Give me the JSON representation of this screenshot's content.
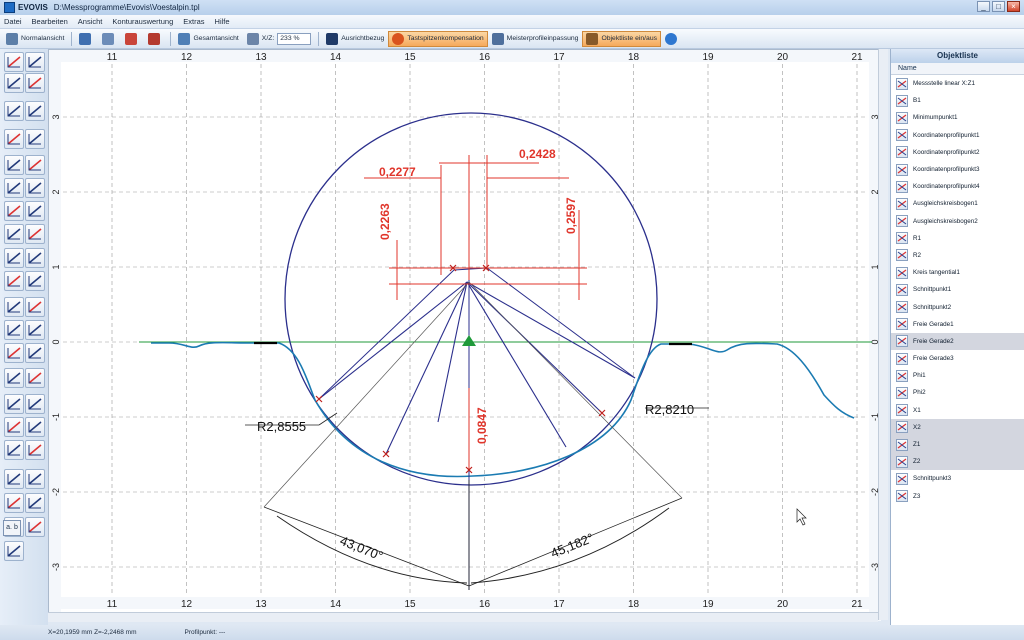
{
  "window": {
    "app_name": "EVOVIS",
    "path": "D:\\Messprogramme\\Evovis\\Voestalpin.tpl"
  },
  "menu": [
    "Datei",
    "Bearbeiten",
    "Ansicht",
    "Konturauswertung",
    "Extras",
    "Hilfe"
  ],
  "toolbar": {
    "normalansicht": "Normalansicht",
    "gesamtansicht": "Gesamtansicht",
    "xz_label": "X/Z:",
    "zoom": "233 %",
    "ausrichtbezug": "Ausrichtbezug",
    "tastspitzen": "Tastspitzenkompensation",
    "meisterprofil": "Meisterprofileinpassung",
    "objektliste": "Objektliste ein/aus"
  },
  "left_tab": "a. b",
  "statusbar": {
    "coords": "X=20,1959 mm Z=-2,2468 mm",
    "profilpunkt": "Profilpunkt: ---"
  },
  "objektliste": {
    "title": "Objektliste",
    "column": "Name",
    "items": [
      {
        "name": "Messstelle linear X:Z1",
        "icon": "profile-line-icon",
        "selected": false
      },
      {
        "name": "B1",
        "icon": "reference-point-icon",
        "selected": false
      },
      {
        "name": "Minimumpunkt1",
        "icon": "minimum-point-icon",
        "selected": false
      },
      {
        "name": "Koordinatenprofilpunkt1",
        "icon": "coordinate-point-icon",
        "selected": false
      },
      {
        "name": "Koordinatenprofilpunkt2",
        "icon": "coordinate-point-icon",
        "selected": false
      },
      {
        "name": "Koordinatenprofilpunkt3",
        "icon": "coordinate-point-icon",
        "selected": false
      },
      {
        "name": "Koordinatenprofilpunkt4",
        "icon": "coordinate-point-icon",
        "selected": false
      },
      {
        "name": "Ausgleichskreisbogen1",
        "icon": "fit-arc-icon",
        "selected": false
      },
      {
        "name": "Ausgleichskreisbogen2",
        "icon": "fit-arc-icon",
        "selected": false
      },
      {
        "name": "R1",
        "icon": "radius-icon",
        "selected": false
      },
      {
        "name": "R2",
        "icon": "radius-icon",
        "selected": false
      },
      {
        "name": "Kreis tangential1",
        "icon": "tangent-circle-icon",
        "selected": false
      },
      {
        "name": "Schnittpunkt1",
        "icon": "intersection-icon",
        "selected": false
      },
      {
        "name": "Schnittpunkt2",
        "icon": "intersection-icon",
        "selected": false
      },
      {
        "name": "Freie Gerade1",
        "icon": "line-icon",
        "selected": false
      },
      {
        "name": "Freie Gerade2",
        "icon": "line-icon",
        "selected": true
      },
      {
        "name": "Freie Gerade3",
        "icon": "line-icon",
        "selected": false
      },
      {
        "name": "Phi1",
        "icon": "angle-icon",
        "selected": false
      },
      {
        "name": "Phi2",
        "icon": "angle-icon",
        "selected": false
      },
      {
        "name": "X1",
        "icon": "x-distance-icon",
        "selected": false
      },
      {
        "name": "X2",
        "icon": "x-distance-icon",
        "selected": true
      },
      {
        "name": "Z1",
        "icon": "z-distance-icon",
        "selected": true
      },
      {
        "name": "Z2",
        "icon": "z-distance-icon",
        "selected": true
      },
      {
        "name": "Schnittpunkt3",
        "icon": "intersection-icon",
        "selected": false
      },
      {
        "name": "Z3",
        "icon": "z-distance-icon",
        "selected": false
      }
    ]
  },
  "axes": {
    "x_ticks": [
      "11",
      "12",
      "13",
      "14",
      "15",
      "16",
      "17",
      "18",
      "19",
      "20",
      "21"
    ],
    "y_ticks": [
      "3",
      "2",
      "1",
      "0",
      "-1",
      "-2",
      "-3"
    ]
  },
  "measurements": {
    "d1": "0,2277",
    "d2": "0,2428",
    "d3": "0,2263",
    "d4": "0,2597",
    "d5": "0,0847",
    "r_left": "R2,8555",
    "r_right": "R2,8210",
    "phi_left": "43,070°",
    "phi_right": "45,182°"
  },
  "colors": {
    "accent": "#f6a95b",
    "dim": "#e0352b",
    "circle": "#2b2f8c",
    "profile": "#1b7bb2",
    "reference": "#1f9a3a"
  }
}
